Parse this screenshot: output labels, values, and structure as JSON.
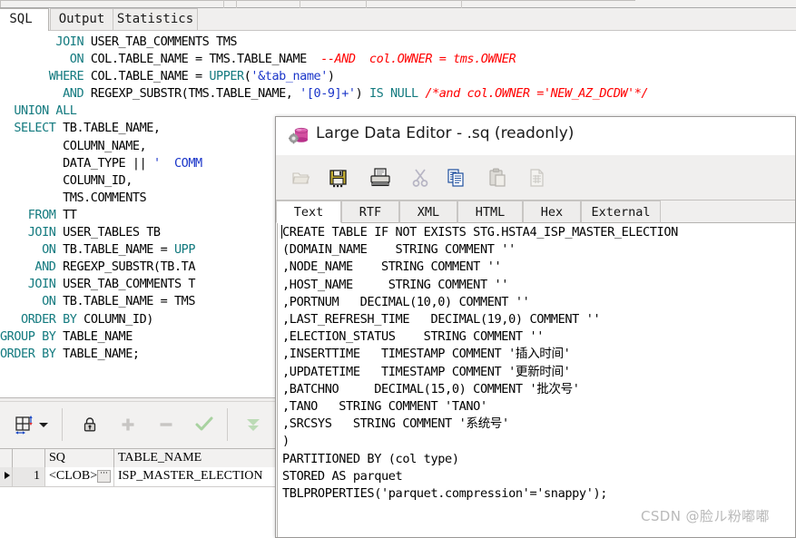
{
  "top_strip": {
    "present": true
  },
  "tabbar": {
    "tabs": [
      {
        "id": "sql",
        "label": "SQL",
        "active": true
      },
      {
        "id": "output",
        "label": "Output",
        "active": false
      },
      {
        "id": "stats",
        "label": "Statistics",
        "active": false
      }
    ]
  },
  "sql_editor": {
    "lines": [
      [
        {
          "t": "        ",
          "c": "op"
        },
        {
          "t": "JOIN",
          "c": "kw"
        },
        {
          "t": " USER_TAB_COMMENTS TMS",
          "c": "op"
        }
      ],
      [
        {
          "t": "          ",
          "c": "op"
        },
        {
          "t": "ON",
          "c": "kw"
        },
        {
          "t": " COL.TABLE_NAME = TMS.TABLE_NAME  ",
          "c": "op"
        },
        {
          "t": "--AND  col.OWNER = tms.OWNER",
          "c": "cmt"
        }
      ],
      [
        {
          "t": "       ",
          "c": "op"
        },
        {
          "t": "WHERE",
          "c": "kw"
        },
        {
          "t": " COL.TABLE_NAME = ",
          "c": "op"
        },
        {
          "t": "UPPER",
          "c": "kw"
        },
        {
          "t": "(",
          "c": "op"
        },
        {
          "t": "'&tab_name'",
          "c": "str"
        },
        {
          "t": ")",
          "c": "op"
        }
      ],
      [
        {
          "t": "         ",
          "c": "op"
        },
        {
          "t": "AND",
          "c": "kw"
        },
        {
          "t": " REGEXP_SUBSTR(TMS.TABLE_NAME, ",
          "c": "op"
        },
        {
          "t": "'[0-9]+'",
          "c": "str"
        },
        {
          "t": ") ",
          "c": "op"
        },
        {
          "t": "IS NULL",
          "c": "kw"
        },
        {
          "t": " ",
          "c": "op"
        },
        {
          "t": "/*and col.OWNER ='NEW_AZ_DCDW'*/",
          "c": "cmt"
        }
      ],
      [
        {
          "t": "  ",
          "c": "op"
        },
        {
          "t": "UNION ALL",
          "c": "kw"
        }
      ],
      [
        {
          "t": "  ",
          "c": "op"
        },
        {
          "t": "SELECT",
          "c": "kw"
        },
        {
          "t": " TB.TABLE_NAME,",
          "c": "op"
        }
      ],
      [
        {
          "t": "         COLUMN_NAME,",
          "c": "op"
        }
      ],
      [
        {
          "t": "         DATA_TYPE ",
          "c": "op"
        },
        {
          "t": "||",
          "c": "op"
        },
        {
          "t": " ",
          "c": "op"
        },
        {
          "t": "'  COMM",
          "c": "str"
        }
      ],
      [
        {
          "t": "         COLUMN_ID,",
          "c": "op"
        }
      ],
      [
        {
          "t": "         TMS.COMMENTS",
          "c": "op"
        }
      ],
      [
        {
          "t": "    ",
          "c": "op"
        },
        {
          "t": "FROM",
          "c": "kw"
        },
        {
          "t": " TT",
          "c": "op"
        }
      ],
      [
        {
          "t": "    ",
          "c": "op"
        },
        {
          "t": "JOIN",
          "c": "kw"
        },
        {
          "t": " USER_TABLES TB",
          "c": "op"
        }
      ],
      [
        {
          "t": "      ",
          "c": "op"
        },
        {
          "t": "ON",
          "c": "kw"
        },
        {
          "t": " TB.TABLE_NAME = ",
          "c": "op"
        },
        {
          "t": "UPP",
          "c": "kw"
        }
      ],
      [
        {
          "t": "     ",
          "c": "op"
        },
        {
          "t": "AND",
          "c": "kw"
        },
        {
          "t": " REGEXP_SUBSTR(TB.TA",
          "c": "op"
        }
      ],
      [
        {
          "t": "    ",
          "c": "op"
        },
        {
          "t": "JOIN",
          "c": "kw"
        },
        {
          "t": " USER_TAB_COMMENTS T",
          "c": "op"
        }
      ],
      [
        {
          "t": "      ",
          "c": "op"
        },
        {
          "t": "ON",
          "c": "kw"
        },
        {
          "t": " TB.TABLE_NAME = TMS",
          "c": "op"
        }
      ],
      [
        {
          "t": "   ",
          "c": "op"
        },
        {
          "t": "ORDER BY",
          "c": "kw"
        },
        {
          "t": " COLUMN_ID)",
          "c": "op"
        }
      ],
      [
        {
          "t": "GROUP BY",
          "c": "kw"
        },
        {
          "t": " TABLE_NAME",
          "c": "op"
        }
      ],
      [
        {
          "t": "ORDER BY",
          "c": "kw"
        },
        {
          "t": " TABLE_NAME;",
          "c": "op"
        }
      ]
    ]
  },
  "grid_toolbar": {
    "buttons": [
      {
        "id": "grid-mode",
        "icon": "grid-resize-icon",
        "enabled": true
      },
      {
        "id": "grid-mode-dd",
        "icon": "chevron-down-icon",
        "enabled": true
      },
      {
        "id": "lock",
        "icon": "lock-icon",
        "enabled": true
      },
      {
        "id": "insert-row",
        "icon": "plus-icon",
        "enabled": false
      },
      {
        "id": "delete-row",
        "icon": "minus-icon",
        "enabled": false
      },
      {
        "id": "commit",
        "icon": "check-icon",
        "enabled": false
      },
      {
        "id": "fetch-all",
        "icon": "double-chevron-down-icon",
        "enabled": false
      }
    ]
  },
  "grid": {
    "columns": [
      "",
      "",
      "SQ",
      "TABLE_NAME"
    ],
    "rows": [
      {
        "indicator": "▶",
        "rownum": "1",
        "sq": "<CLOB>",
        "table_name": "ISP_MASTER_ELECTION",
        "ellipsis": "···"
      }
    ]
  },
  "large_data_editor": {
    "title": "Large Data Editor - .sq (readonly)",
    "title_icon": "database-gear-icon",
    "toolbar": [
      {
        "id": "open",
        "icon": "open-folder-icon",
        "enabled": false
      },
      {
        "id": "save",
        "icon": "save-floppy-icon",
        "enabled": true
      },
      {
        "id": "print",
        "icon": "printer-icon",
        "enabled": true
      },
      {
        "id": "cut",
        "icon": "scissors-icon",
        "enabled": false
      },
      {
        "id": "copy",
        "icon": "copy-pages-icon",
        "enabled": true
      },
      {
        "id": "paste",
        "icon": "clipboard-icon",
        "enabled": false
      },
      {
        "id": "export",
        "icon": "export-sheet-icon",
        "enabled": false
      }
    ],
    "tabs": [
      {
        "id": "text",
        "label": "Text",
        "active": true
      },
      {
        "id": "rtf",
        "label": "RTF",
        "active": false
      },
      {
        "id": "xml",
        "label": "XML",
        "active": false
      },
      {
        "id": "html",
        "label": "HTML",
        "active": false
      },
      {
        "id": "hex",
        "label": "Hex",
        "active": false
      },
      {
        "id": "external",
        "label": "External",
        "active": false
      }
    ],
    "content": "CREATE TABLE IF NOT EXISTS STG.HSTA4_ISP_MASTER_ELECTION\n(DOMAIN_NAME    STRING COMMENT ''\n,NODE_NAME    STRING COMMENT ''\n,HOST_NAME     STRING COMMENT ''\n,PORTNUM   DECIMAL(10,0) COMMENT ''\n,LAST_REFRESH_TIME   DECIMAL(19,0) COMMENT ''\n,ELECTION_STATUS    STRING COMMENT ''\n,INSERTTIME   TIMESTAMP COMMENT '插入时间'\n,UPDATETIME   TIMESTAMP COMMENT '更新时间'\n,BATCHNO     DECIMAL(15,0) COMMENT '批次号'\n,TANO   STRING COMMENT 'TANO'\n,SRCSYS   STRING COMMENT '系统号'\n)\nPARTITIONED BY (col type)\nSTORED AS parquet\nTBLPROPERTIES('parquet.compression'='snappy');"
  },
  "watermark": {
    "text": "CSDN @脸ル粉嘟嘟"
  },
  "colors": {
    "keyword": "#137a7f",
    "comment": "#ff0000",
    "string": "#1b36c9",
    "window_bg": "#f0efee",
    "editor_bg": "#ffffff",
    "title_icon": "#d34fa0"
  }
}
